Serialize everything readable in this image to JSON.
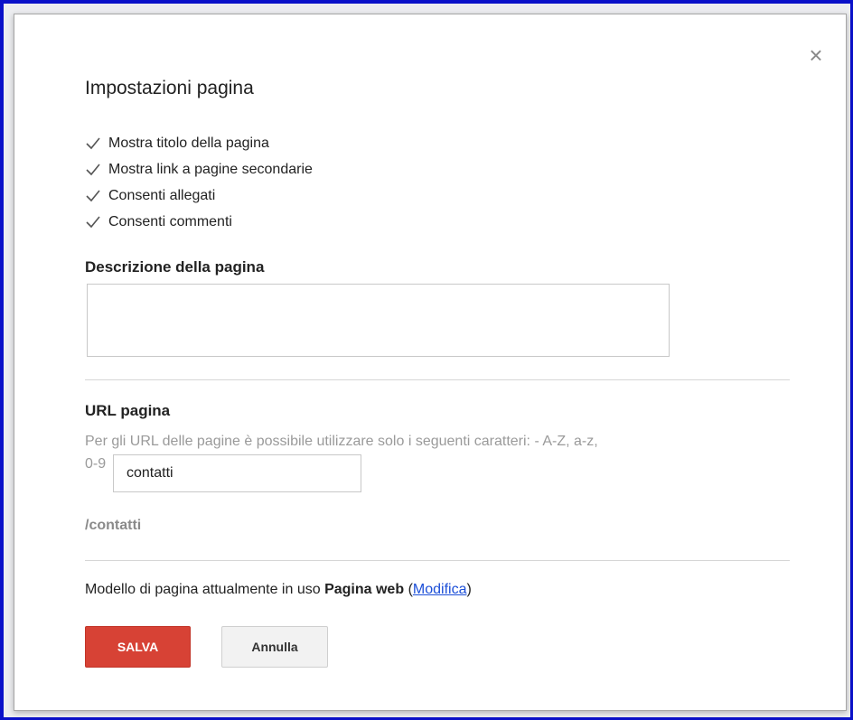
{
  "dialog": {
    "title": "Impostazioni pagina",
    "close_symbol": "×"
  },
  "checkboxes": [
    {
      "label": "Mostra titolo della pagina",
      "checked": true
    },
    {
      "label": "Mostra link a pagine secondarie",
      "checked": true
    },
    {
      "label": "Consenti allegati",
      "checked": true
    },
    {
      "label": "Consenti commenti",
      "checked": true
    }
  ],
  "description": {
    "label": "Descrizione della pagina",
    "value": ""
  },
  "url": {
    "label": "URL pagina",
    "help": "Per gli URL delle pagine è possibile utilizzare solo i seguenti caratteri: - A-Z, a-z,",
    "help_suffix": "0-9",
    "value": "contatti",
    "path": "/contatti"
  },
  "template": {
    "prefix": "Modello di pagina attualmente in uso",
    "name": "Pagina web",
    "open_paren": "(",
    "link": "Modifica",
    "close_paren": ")"
  },
  "buttons": {
    "save": "SALVA",
    "cancel": "Annulla"
  },
  "colors": {
    "background_border": "#0a11c9",
    "save_button": "#d74235",
    "link": "#1c4fd8"
  }
}
